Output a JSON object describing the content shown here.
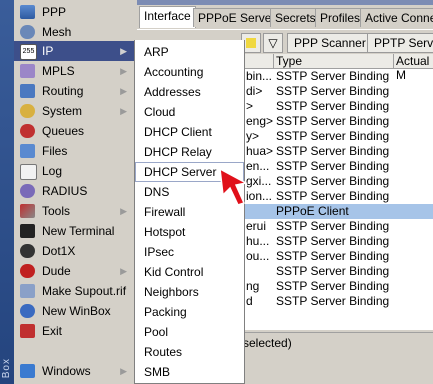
{
  "main_menu": {
    "items": [
      {
        "label": "PPP",
        "icon": "ppp-icon",
        "arrow": false
      },
      {
        "label": "Mesh",
        "icon": "mesh-icon",
        "arrow": false
      },
      {
        "label": "IP",
        "icon": "ip-icon",
        "arrow": true
      },
      {
        "label": "MPLS",
        "icon": "mpls-icon",
        "arrow": true
      },
      {
        "label": "Routing",
        "icon": "routing-icon",
        "arrow": true
      },
      {
        "label": "System",
        "icon": "system-icon",
        "arrow": true
      },
      {
        "label": "Queues",
        "icon": "queues-icon",
        "arrow": false
      },
      {
        "label": "Files",
        "icon": "files-icon",
        "arrow": false
      },
      {
        "label": "Log",
        "icon": "log-icon",
        "arrow": false
      },
      {
        "label": "RADIUS",
        "icon": "radius-icon",
        "arrow": false
      },
      {
        "label": "Tools",
        "icon": "tools-icon",
        "arrow": true
      },
      {
        "label": "New Terminal",
        "icon": "terminal-icon",
        "arrow": false
      },
      {
        "label": "Dot1X",
        "icon": "dot1x-icon",
        "arrow": false
      },
      {
        "label": "Dude",
        "icon": "dude-icon",
        "arrow": true
      },
      {
        "label": "Make Supout.rif",
        "icon": "supout-icon",
        "arrow": false
      },
      {
        "label": "New WinBox",
        "icon": "winbox-icon",
        "arrow": false
      },
      {
        "label": "Exit",
        "icon": "exit-icon",
        "arrow": false
      },
      {
        "label": "Windows",
        "icon": "windows-icon",
        "arrow": true
      }
    ]
  },
  "side_strip_text": "Box",
  "ip_submenu": {
    "items": [
      "ARP",
      "Accounting",
      "Addresses",
      "Cloud",
      "DHCP Client",
      "DHCP Relay",
      "DHCP Server",
      "DNS",
      "Firewall",
      "Hotspot",
      "IPsec",
      "Kid Control",
      "Neighbors",
      "Packing",
      "Pool",
      "Routes",
      "SMB"
    ]
  },
  "window": {
    "tabs": [
      "Interface",
      "PPPoE Servers",
      "Secrets",
      "Profiles",
      "Active Connecti"
    ],
    "toolbar": {
      "ppp_scanner": "PPP Scanner",
      "pptp_server": "PPTP Server"
    },
    "columns": [
      "Type",
      "Actual M"
    ],
    "rows": [
      {
        "name": "bin...",
        "type": "SSTP Server Binding"
      },
      {
        "name": "di>",
        "type": "SSTP Server Binding"
      },
      {
        "name": ">",
        "type": "SSTP Server Binding"
      },
      {
        "name": "eng>",
        "type": "SSTP Server Binding"
      },
      {
        "name": "y>",
        "type": "SSTP Server Binding"
      },
      {
        "name": "hua>",
        "type": "SSTP Server Binding"
      },
      {
        "name": "en...",
        "type": "SSTP Server Binding"
      },
      {
        "name": "gxi...",
        "type": "SSTP Server Binding"
      },
      {
        "name": "ion...",
        "type": "SSTP Server Binding"
      },
      {
        "name": "",
        "type": "PPPoE Client"
      },
      {
        "name": "erui",
        "type": "SSTP Server Binding"
      },
      {
        "name": "hu...",
        "type": "SSTP Server Binding"
      },
      {
        "name": "ou...",
        "type": "SSTP Server Binding"
      },
      {
        "name": "",
        "type": "SSTP Server Binding"
      },
      {
        "name": "ng",
        "type": "SSTP Server Binding"
      },
      {
        "name": "d",
        "type": "SSTP Server Binding"
      }
    ],
    "status": "selected)"
  },
  "colors": {
    "selection": "#3d4f8a",
    "row_highlight": "#a6c4e8",
    "arrow": "#e0101a"
  }
}
